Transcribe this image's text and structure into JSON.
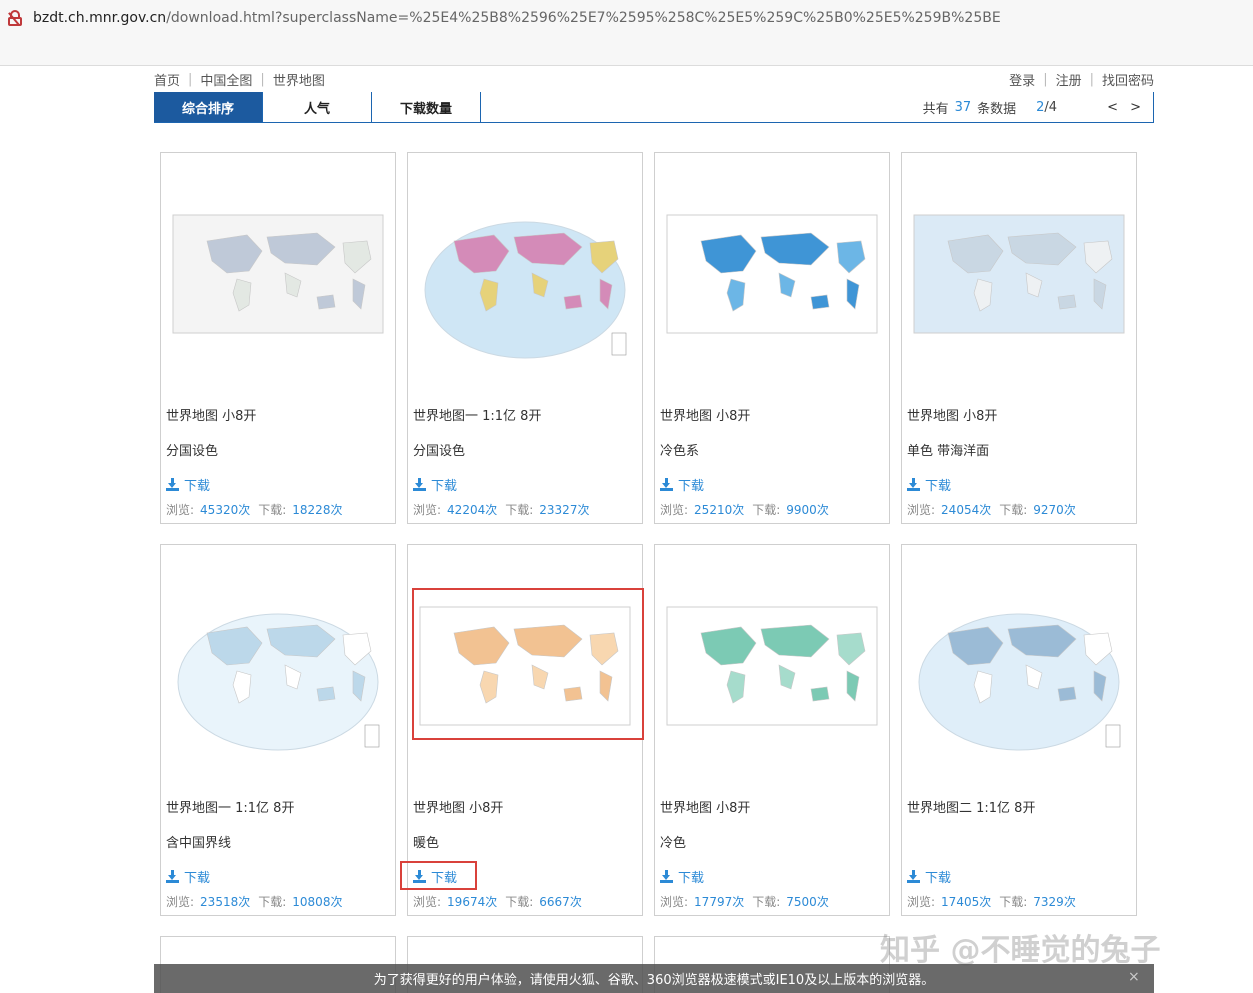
{
  "browser": {
    "url_host": "bzdt.ch.mnr.gov.cn",
    "url_path": "/download.html?superclassName=%25E4%25B8%2596%25E7%2595%258C%25E5%259C%25B0%25E5%259B%25BE"
  },
  "topnav": {
    "left": [
      "首页",
      "中国全图",
      "世界地图"
    ],
    "right": [
      "登录",
      "注册",
      "找回密码"
    ]
  },
  "tabs": [
    "综合排序",
    "人气",
    "下载数量"
  ],
  "pager": {
    "prefix": "共有",
    "total": "37",
    "suffix": "条数据",
    "current": "2",
    "pages": "/4",
    "arrows": "< >"
  },
  "cards": [
    {
      "title": "世界地图 小8开",
      "sub": "分国设色",
      "download": "下载",
      "views_label": "浏览:",
      "views": "45320次",
      "dls_label": "下载:",
      "dls": "18228次",
      "style": "political-light"
    },
    {
      "title": "世界地图一 1:1亿 8开",
      "sub": "分国设色",
      "download": "下载",
      "views_label": "浏览:",
      "views": "42204次",
      "dls_label": "下载:",
      "dls": "23327次",
      "style": "political-oval"
    },
    {
      "title": "世界地图 小8开",
      "sub": "冷色系",
      "download": "下载",
      "views_label": "浏览:",
      "views": "25210次",
      "dls_label": "下载:",
      "dls": "9900次",
      "style": "cool"
    },
    {
      "title": "世界地图 小8开",
      "sub": "单色 带海洋面",
      "download": "下载",
      "views_label": "浏览:",
      "views": "24054次",
      "dls_label": "下载:",
      "dls": "9270次",
      "style": "mono-ocean"
    },
    {
      "title": "世界地图一 1:1亿 8开",
      "sub": "含中国界线",
      "download": "下载",
      "views_label": "浏览:",
      "views": "23518次",
      "dls_label": "下载:",
      "dls": "10808次",
      "style": "outline-oval"
    },
    {
      "title": "世界地图 小8开",
      "sub": "暖色",
      "download": "下载",
      "views_label": "浏览:",
      "views": "19674次",
      "dls_label": "下载:",
      "dls": "6667次",
      "style": "warm"
    },
    {
      "title": "世界地图 小8开",
      "sub": "冷色",
      "download": "下载",
      "views_label": "浏览:",
      "views": "17797次",
      "dls_label": "下载:",
      "dls": "7500次",
      "style": "teal"
    },
    {
      "title": "世界地图二 1:1亿 8开",
      "sub": "",
      "download": "下载",
      "views_label": "浏览:",
      "views": "17405次",
      "dls_label": "下载:",
      "dls": "7329次",
      "style": "detailed-oval"
    }
  ],
  "notice": "为了获得更好的用户体验，请使用火狐、谷歌、360浏览器极速模式或IE10及以上版本的浏览器。",
  "notice_close": "×",
  "watermark": "知乎 @不睡觉的兔子",
  "colors": {
    "accent": "#1c5a9f",
    "link": "#2c8ad6",
    "highlight": "#d9413b"
  }
}
